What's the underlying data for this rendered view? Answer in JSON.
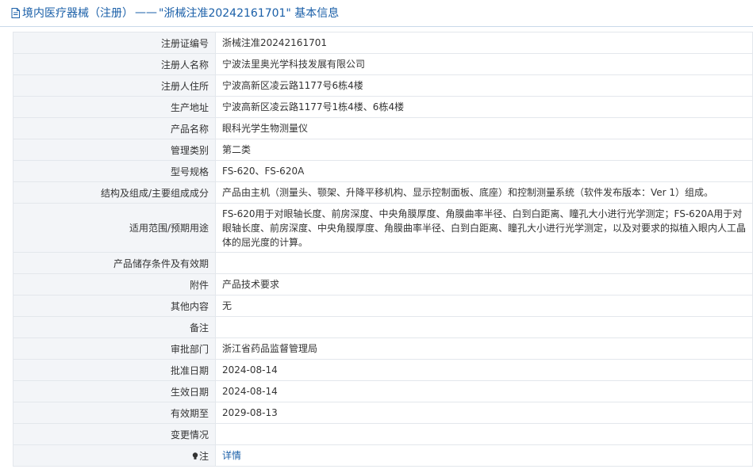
{
  "header": {
    "category": "境内医疗器械（注册）",
    "separator": "——",
    "reg_title": "\"浙械注准20242161701\" 基本信息"
  },
  "rows": [
    {
      "label": "注册证编号",
      "value": "浙械注准20242161701"
    },
    {
      "label": "注册人名称",
      "value": "宁波法里奥光学科技发展有限公司"
    },
    {
      "label": "注册人住所",
      "value": "宁波高新区凌云路1177号6栋4楼"
    },
    {
      "label": "生产地址",
      "value": "宁波高新区凌云路1177号1栋4楼、6栋4楼"
    },
    {
      "label": "产品名称",
      "value": "眼科光学生物测量仪"
    },
    {
      "label": "管理类别",
      "value": "第二类"
    },
    {
      "label": "型号规格",
      "value": "FS-620、FS-620A"
    },
    {
      "label": "结构及组成/主要组成成分",
      "value": "产品由主机（测量头、颚架、升降平移机构、显示控制面板、底座）和控制测量系统（软件发布版本：Ver 1）组成。"
    },
    {
      "label": "适用范围/预期用途",
      "value": "FS-620用于对眼轴长度、前房深度、中央角膜厚度、角膜曲率半径、白到白距离、瞳孔大小进行光学测定；FS-620A用于对眼轴长度、前房深度、中央角膜厚度、角膜曲率半径、白到白距离、瞳孔大小进行光学测定，以及对要求的拟植入眼内人工晶体的屈光度的计算。"
    },
    {
      "label": "产品储存条件及有效期",
      "value": ""
    },
    {
      "label": "附件",
      "value": "产品技术要求"
    },
    {
      "label": "其他内容",
      "value": "无"
    },
    {
      "label": "备注",
      "value": ""
    },
    {
      "label": "审批部门",
      "value": "浙江省药品监督管理局"
    },
    {
      "label": "批准日期",
      "value": "2024-08-14"
    },
    {
      "label": "生效日期",
      "value": "2024-08-14"
    },
    {
      "label": "有效期至",
      "value": "2029-08-13"
    },
    {
      "label": "变更情况",
      "value": ""
    }
  ],
  "note_row": {
    "label": "注",
    "value": "详情"
  },
  "colors": {
    "link": "#1a5fa8",
    "label_bg": "#f3f5f8",
    "border": "#e3e7ec"
  }
}
